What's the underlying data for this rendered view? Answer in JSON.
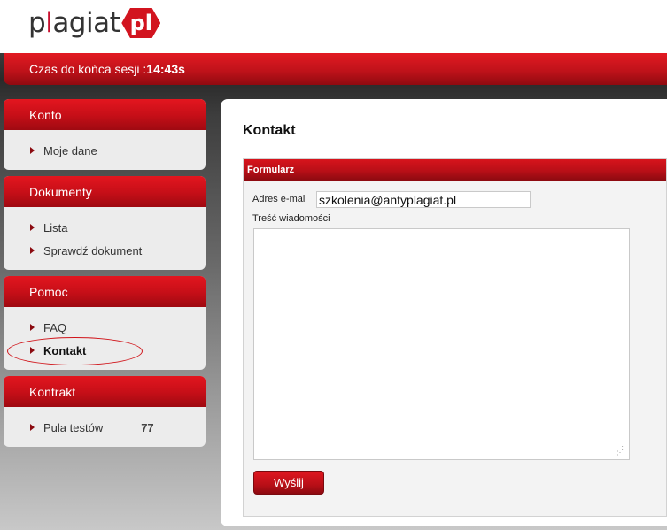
{
  "header": {
    "logo_pre": "p",
    "logo_red": "l",
    "logo_post": "agiat",
    "logo_badge": "pl"
  },
  "session": {
    "label": "Czas do końca sesji :",
    "time": "14:43s"
  },
  "sidebar": [
    {
      "title": "Konto",
      "items": [
        {
          "label": "Moje dane"
        }
      ]
    },
    {
      "title": "Dokumenty",
      "items": [
        {
          "label": "Lista"
        },
        {
          "label": "Sprawdź dokument"
        }
      ]
    },
    {
      "title": "Pomoc",
      "items": [
        {
          "label": "FAQ"
        },
        {
          "label": "Kontakt",
          "active": true
        }
      ]
    },
    {
      "title": "Kontrakt",
      "items": [
        {
          "label": "Pula testów",
          "count": "77"
        }
      ]
    }
  ],
  "main": {
    "title": "Kontakt",
    "form": {
      "title": "Formularz",
      "email_label": "Adres e-mail",
      "email_value": "szkolenia@antyplagiat.pl",
      "message_label": "Treść wiadomości",
      "message_value": "",
      "submit_label": "Wyślij"
    }
  },
  "colors": {
    "accent_red": "#c8102e",
    "annotation_circle": "#d01218"
  }
}
